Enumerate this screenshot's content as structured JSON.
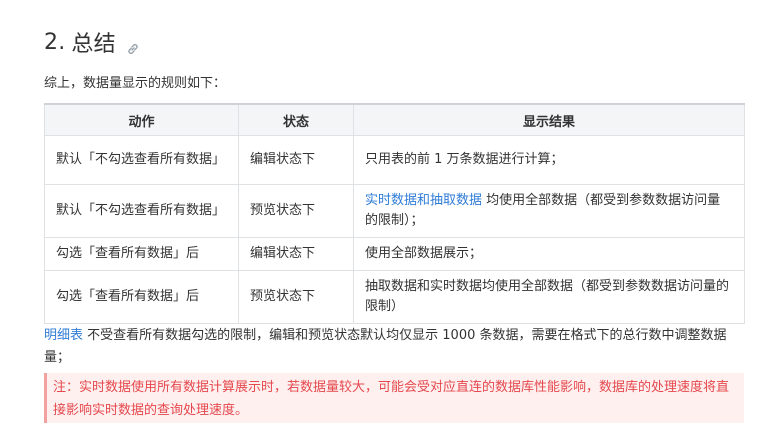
{
  "section": {
    "number": "2.",
    "title": "总结"
  },
  "intro": "综上，数据量显示的规则如下：",
  "table": {
    "headers": [
      "动作",
      "状态",
      "显示结果"
    ],
    "rows": [
      {
        "action": "默认「不勾选查看所有数据」",
        "state": "编辑状态下",
        "result": "只用表的前 1 万条数据进行计算；"
      },
      {
        "action": "默认「不勾选查看所有数据」",
        "state": "预览状态下",
        "result_link": "实时数据和抽取数据",
        "result_rest": " 均使用全部数据（都受到参数数据访问量的限制）；"
      },
      {
        "action": "勾选「查看所有数据」后",
        "state": "编辑状态下",
        "result": "使用全部数据展示；"
      },
      {
        "action": "勾选「查看所有数据」后",
        "state": "预览状态下",
        "result": "抽取数据和实时数据均使用全部数据（都受到参数数据访问量的限制）"
      }
    ]
  },
  "footer": {
    "link": "明细表",
    "text": " 不受查看所有数据勾选的限制，编辑和预览状态默认均仅显示 1000 条数据，需要在格式下的总行数中调整数据量；"
  },
  "note": "注：实时数据使用所有数据计算展示时，若数据量较大，可能会受对应直连的数据库性能影响，数据库的处理速度将直接影响实时数据的查询处理速度。",
  "colors": {
    "link": "#2f7cd6",
    "note_text": "#e5484d",
    "note_bg": "#fff0f0",
    "note_border": "#f2a0a0"
  },
  "icons": {
    "heading_anchor": "link-icon"
  }
}
